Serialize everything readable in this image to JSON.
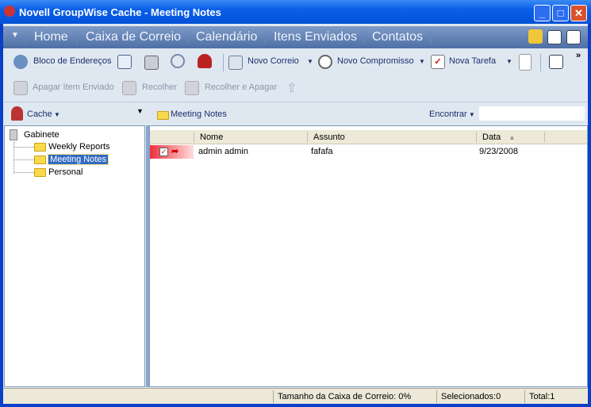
{
  "window": {
    "title": "Novell GroupWise Cache - Meeting Notes"
  },
  "nav": {
    "tabs": [
      "Home",
      "Caixa de Correio",
      "Calendário",
      "Itens Enviados",
      "Contatos"
    ]
  },
  "toolbar": {
    "address_book": "Bloco de Endereços",
    "new_mail": "Novo Correio",
    "new_appointment": "Novo Compromisso",
    "new_task": "Nova Tarefa",
    "overflow": "»"
  },
  "toolbar2": {
    "delete_sent": "Apagar Item Enviado",
    "retract": "Recolher",
    "retract_delete": "Recolher e Apagar"
  },
  "left_header": {
    "cache": "Cache"
  },
  "folder_header": {
    "title": "Meeting Notes",
    "find": "Encontrar",
    "find_value": ""
  },
  "tree": {
    "root": "Gabinete",
    "folders": [
      "Weekly Reports",
      "Meeting Notes",
      "Personal"
    ],
    "selected": "Meeting Notes"
  },
  "table": {
    "columns": [
      "Nome",
      "Assunto",
      "Data"
    ],
    "rows": [
      {
        "name": "admin admin",
        "subject": "fafafa",
        "date": "9/23/2008"
      }
    ]
  },
  "status": {
    "mailbox_size": "Tamanho da Caixa de Correio: 0%",
    "selected": "Selecionados:0",
    "total": "Total:1"
  }
}
